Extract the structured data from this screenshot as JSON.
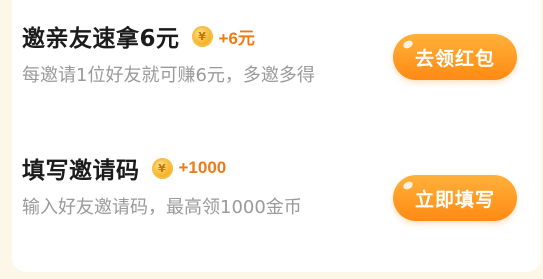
{
  "tasks": [
    {
      "title": "邀亲友速拿6元",
      "reward": "+6元",
      "description": "每邀请1位好友就可赚6元，多邀多得",
      "button_label": "去领红包"
    },
    {
      "title": "填写邀请码",
      "reward": "+1000",
      "description": "输入好友邀请码，最高领1000金币",
      "button_label": "立即填写"
    }
  ],
  "icons": {
    "coin": "coin-icon",
    "coin_glyph": "¥"
  },
  "colors": {
    "reward_text": "#f07a12",
    "button_gradient_top": "#ffb13a",
    "button_gradient_bottom": "#ff8a14",
    "description_text": "#9a9a9a"
  }
}
